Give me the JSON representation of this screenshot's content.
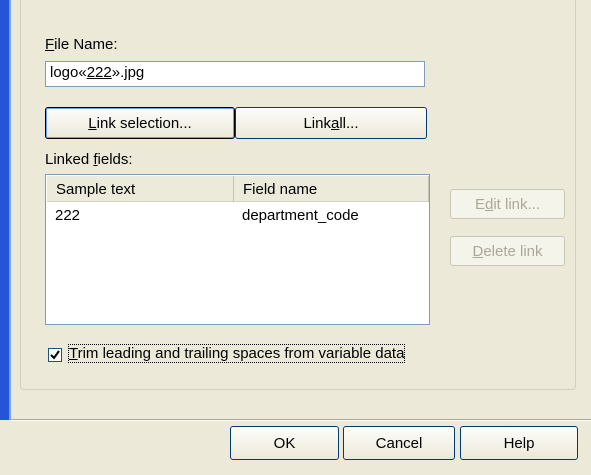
{
  "file_name": {
    "label_prefix": "",
    "label_mnemonic": "F",
    "label_rest": "ile Name:",
    "value_prefix": "logo«",
    "value_link": "222",
    "value_suffix": "».jpg"
  },
  "buttons": {
    "link_selection": {
      "mnemonic": "L",
      "rest": "ink selection..."
    },
    "link_all": {
      "prefix": "Link ",
      "mnemonic": "a",
      "rest": "ll..."
    },
    "edit_link": {
      "prefix": "E",
      "mnemonic": "d",
      "rest": "it link..."
    },
    "delete_link": {
      "mnemonic": "D",
      "rest": "elete link"
    },
    "ok": "OK",
    "cancel": "Cancel",
    "help": "Help"
  },
  "linked_fields": {
    "label_prefix": "Linked ",
    "label_mnemonic": "f",
    "label_rest": "ields:",
    "columns": [
      "Sample text",
      "Field name"
    ],
    "rows": [
      {
        "sample_text": "222",
        "field_name": "department_code"
      }
    ]
  },
  "trim_option": {
    "checked": true,
    "label_mnemonic": "T",
    "label_rest": "rim leading and trailing spaces from variable data"
  },
  "colors": {
    "dialog_bg": "#ece9d8",
    "window_frame": "#2455d6",
    "disabled_text": "#aca899"
  }
}
